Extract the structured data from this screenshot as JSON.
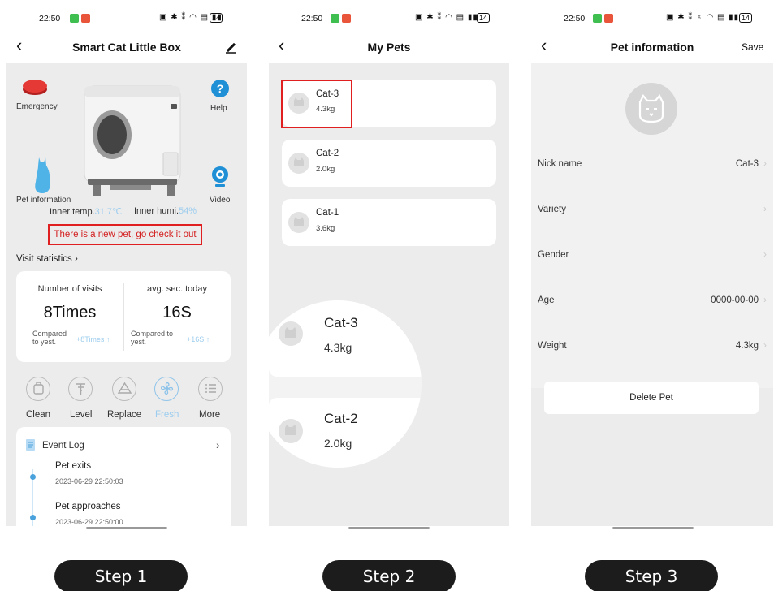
{
  "status_bar": {
    "time": "22:50",
    "battery": "14"
  },
  "screen1": {
    "title": "Smart Cat Little Box",
    "emergency_label": "Emergency",
    "help_label": "Help",
    "pet_info_label": "Pet information",
    "video_label": "Video",
    "inner_temp_label": "Inner temp.",
    "inner_temp_value": "31.7℃",
    "inner_humi_label": "Inner humi.",
    "inner_humi_value": "54%",
    "new_pet_notice": "There is a new pet, go check it out",
    "visit_statistics": "Visit statistics",
    "visits_label": "Number of visits",
    "visits_value": "8Times",
    "visits_compare_label": "Compared to yest.",
    "visits_compare_value": "+8Times",
    "avg_label": "avg. sec. today",
    "avg_value": "16S",
    "avg_compare_label": "Compared to yest.",
    "avg_compare_value": "+16S",
    "functions": [
      {
        "label": "Clean",
        "icon": "clean-icon",
        "active": false
      },
      {
        "label": "Level",
        "icon": "level-icon",
        "active": false
      },
      {
        "label": "Replace",
        "icon": "replace-icon",
        "active": false
      },
      {
        "label": "Fresh",
        "icon": "fresh-icon",
        "active": true
      },
      {
        "label": "More",
        "icon": "more-icon",
        "active": false
      }
    ],
    "event_log_title": "Event Log",
    "events": [
      {
        "title": "Pet exits",
        "time": "2023-06-29 22:50:03"
      },
      {
        "title": "Pet approaches",
        "time": "2023-06-29 22:50:00"
      }
    ]
  },
  "screen2": {
    "title": "My Pets",
    "pets": [
      {
        "name": "Cat-3",
        "weight": "4.3kg"
      },
      {
        "name": "Cat-2",
        "weight": "2.0kg"
      },
      {
        "name": "Cat-1",
        "weight": "3.6kg"
      }
    ],
    "zoom": [
      {
        "name": "Cat-3",
        "weight": "4.3kg"
      },
      {
        "name": "Cat-2",
        "weight": "2.0kg"
      }
    ]
  },
  "screen3": {
    "title": "Pet information",
    "save_label": "Save",
    "fields": [
      {
        "label": "Nick name",
        "value": "Cat-3"
      },
      {
        "label": "Variety",
        "value": ""
      },
      {
        "label": "Gender",
        "value": ""
      },
      {
        "label": "Age",
        "value": "0000-00-00"
      },
      {
        "label": "Weight",
        "value": "4.3kg"
      }
    ],
    "delete_label": "Delete Pet"
  },
  "steps": [
    "Step 1",
    "Step 2",
    "Step 3"
  ],
  "colors": {
    "accent": "#2d9cdb",
    "highlight": "#e02020",
    "emergency": "#e53935"
  }
}
